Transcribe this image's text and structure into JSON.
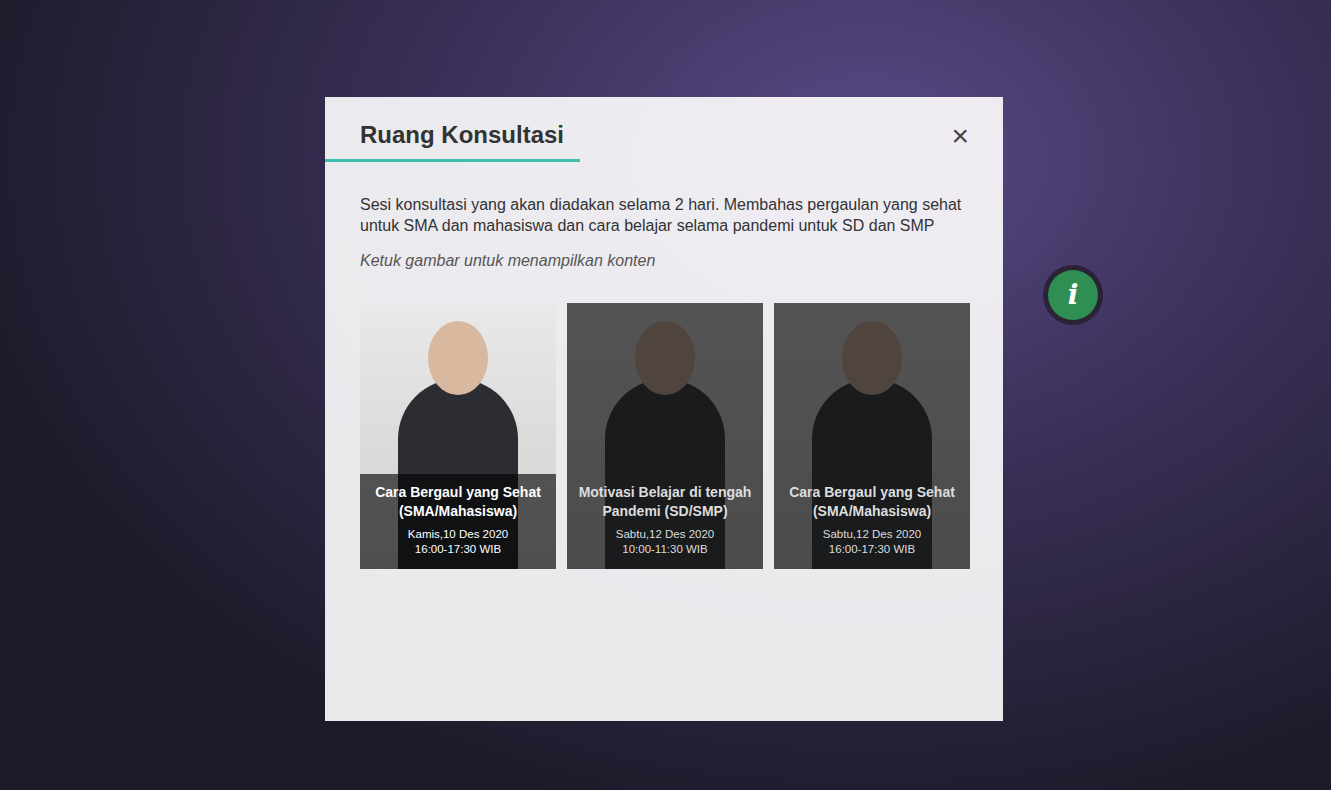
{
  "info_button": {
    "icon": "i"
  },
  "modal": {
    "title": "Ruang Konsultasi",
    "close": "×",
    "description": "Sesi konsultasi yang akan diadakan selama 2 hari. Membahas pergaulan yang sehat untuk SMA dan mahasiswa dan cara belajar selama pandemi untuk SD dan SMP",
    "hint": "Ketuk gambar untuk menampilkan konten"
  },
  "sessions": [
    {
      "title": "Cara Bergaul yang Sehat (SMA/Mahasiswa)",
      "date": "Kamis,10 Des 2020",
      "time": "16:00-17:30 WIB",
      "selected": true
    },
    {
      "title": "Motivasi Belajar di tengah Pandemi (SD/SMP)",
      "date": "Sabtu,12 Des 2020",
      "time": "10:00-11:30 WIB",
      "selected": false
    },
    {
      "title": "Cara Bergaul yang Sehat (SMA/Mahasiswa)",
      "date": "Sabtu,12 Des 2020",
      "time": "16:00-17:30 WIB",
      "selected": false
    }
  ]
}
